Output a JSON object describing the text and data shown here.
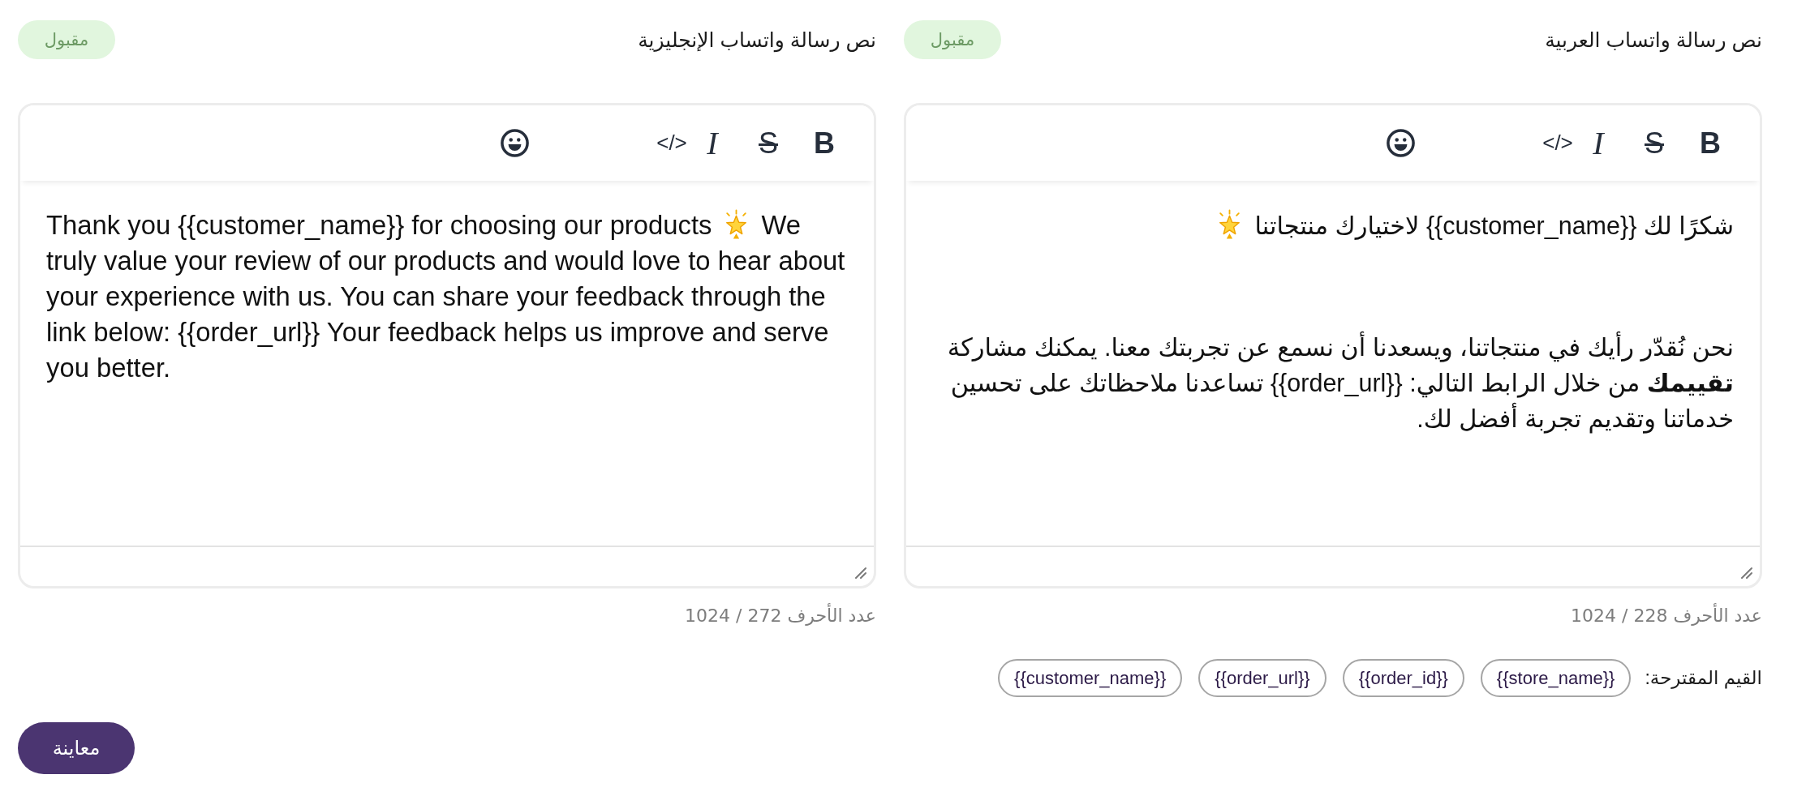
{
  "editors": [
    {
      "title": "نص رسالة واتساب العربية",
      "badge": "مقبول",
      "toolbar": [
        {
          "kind": "bold",
          "label": "B"
        },
        {
          "kind": "strike",
          "label": "S"
        },
        {
          "kind": "italic",
          "label": "I"
        },
        {
          "kind": "code",
          "label": "</>"
        },
        {
          "kind": "emoji"
        }
      ],
      "paragraphs": [
        [
          {
            "kind": "text",
            "text": "شكرًا لك {{customer_name}} لاختيارك منتجاتنا"
          },
          {
            "kind": "star"
          }
        ],
        [
          {
            "kind": "text",
            "text": "نحن نُقدّر رأيك في منتجاتنا، ويسعدنا أن نسمع عن تجربتك معنا. يمكنك مشاركة **تقييمك** من خلال الرابط التالي: {{order_url}} تساعدنا ملاحظاتك على تحسين خدماتنا وتقديم تجربة أفضل لك."
          }
        ]
      ],
      "counter": "عدد الأحرف 228 / 1024",
      "suggestions": {
        "label": "القيم المقترحة:",
        "values": [
          "{{store_name}}",
          "{{order_id}}",
          "{{order_url}}",
          "{{customer_name}}"
        ]
      }
    },
    {
      "title": "نص رسالة واتساب الإنجليزية",
      "badge": "مقبول",
      "toolbar": [
        {
          "kind": "bold",
          "label": "B"
        },
        {
          "kind": "strike",
          "label": "S"
        },
        {
          "kind": "italic",
          "label": "I"
        },
        {
          "kind": "code",
          "label": "</>"
        },
        {
          "kind": "emoji"
        }
      ],
      "paragraphs": [
        [
          {
            "kind": "text",
            "text": "Thank you {{customer_name}} for choosing our products"
          },
          {
            "kind": "star"
          },
          {
            "kind": "text",
            "text": "We truly value your review of our products and would love to hear about your experience with us. You can share your feedback through the link below: {{order_url}} Your feedback helps us improve and serve you better."
          }
        ]
      ],
      "counter": "عدد الأحرف 272 / 1024"
    }
  ],
  "preview_button": "معاينة"
}
